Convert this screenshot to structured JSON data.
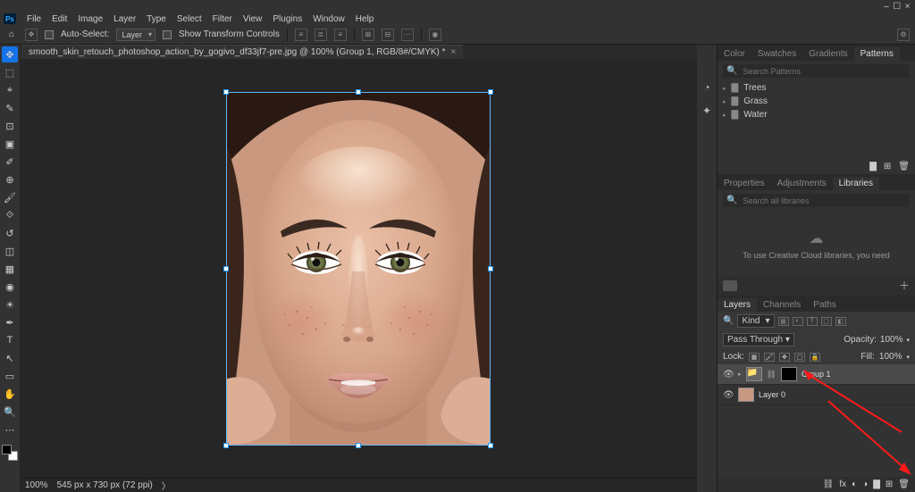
{
  "titlebar": {
    "minimize": "–",
    "maximize": "☐",
    "close": "×"
  },
  "menu": {
    "items": [
      "File",
      "Edit",
      "Image",
      "Layer",
      "Type",
      "Select",
      "Filter",
      "View",
      "Plugins",
      "Window",
      "Help"
    ]
  },
  "options": {
    "auto_select": "Auto-Select:",
    "layer_dropdown": "Layer",
    "show_transform": "Show Transform Controls"
  },
  "doc": {
    "title": "smooth_skin_retouch_photoshop_action_by_gogivo_df33jf7-pre.jpg @ 100% (Group 1, RGB/8#/CMYK) *"
  },
  "status": {
    "zoom": "100%",
    "dims": "545 px x 730 px (72 ppi)"
  },
  "panels": {
    "color_tabs": [
      "Color",
      "Swatches",
      "Gradients",
      "Patterns"
    ],
    "search_patterns_placeholder": "Search Patterns",
    "pattern_folders": [
      "Trees",
      "Grass",
      "Water"
    ],
    "prop_tabs": [
      "Properties",
      "Adjustments",
      "Libraries"
    ],
    "lib_search_placeholder": "Search all libraries",
    "lib_message": "To use Creative Cloud libraries, you need",
    "layer_tabs": [
      "Layers",
      "Channels",
      "Paths"
    ]
  },
  "layers": {
    "kind_label": "Kind",
    "blend_mode": "Pass Through",
    "opacity_label": "Opacity:",
    "opacity_value": "100%",
    "lock_label": "Lock:",
    "fill_label": "Fill:",
    "fill_value": "100%",
    "items": [
      {
        "name": "Group 1",
        "type": "group",
        "selected": true,
        "masked": true
      },
      {
        "name": "Layer 0",
        "type": "image",
        "selected": false
      }
    ]
  }
}
